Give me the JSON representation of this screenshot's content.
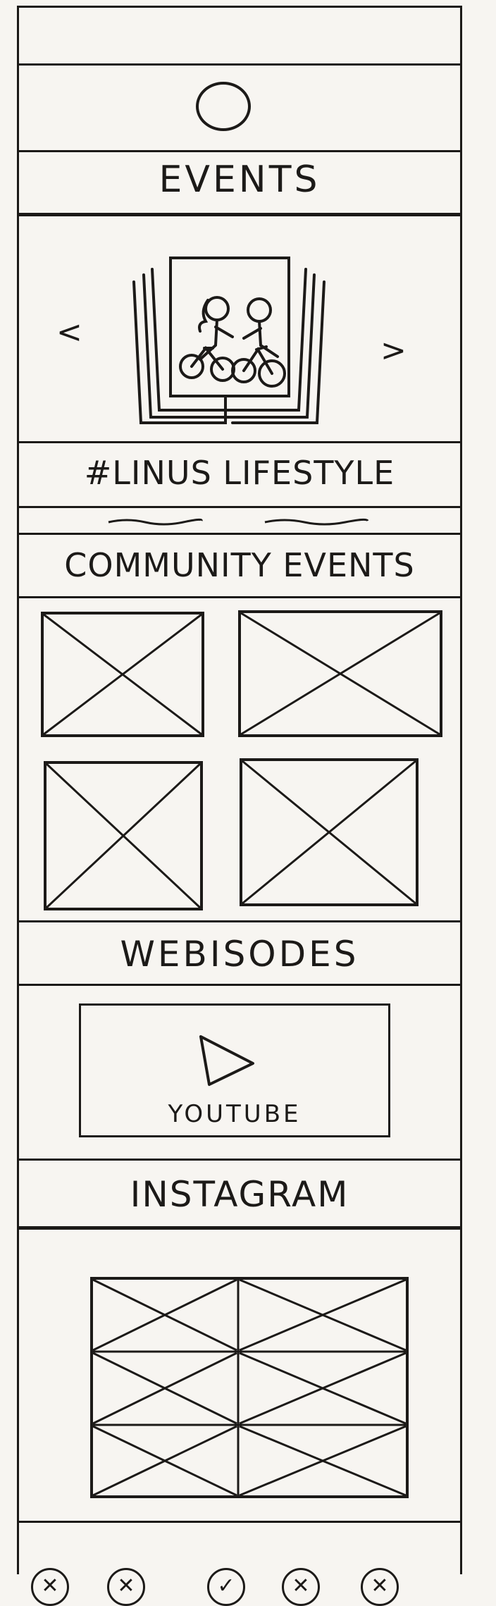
{
  "header": {
    "logo_icon": "circle-logo-icon"
  },
  "events": {
    "title": "EVENTS",
    "carousel": {
      "prev_label": "<",
      "next_label": ">",
      "image_icon": "cyclists-photo-stack-icon"
    },
    "hashtag": "#LINUS LIFESTYLE"
  },
  "community_events": {
    "title": "COMMUNITY EVENTS",
    "placeholders": [
      "image-placeholder",
      "image-placeholder",
      "image-placeholder",
      "image-placeholder"
    ]
  },
  "webisodes": {
    "title": "WEBISODES",
    "video_label": "YOUTUBE",
    "play_icon": "play-icon"
  },
  "instagram": {
    "title": "INSTAGRAM",
    "grid_icon": "image-grid-placeholder"
  },
  "bottom_nav": {
    "items": [
      {
        "icon": "x-circle-icon"
      },
      {
        "icon": "x-circle-icon"
      },
      {
        "icon": "check-circle-icon"
      },
      {
        "icon": "x-circle-icon"
      },
      {
        "icon": "x-circle-icon"
      }
    ]
  }
}
